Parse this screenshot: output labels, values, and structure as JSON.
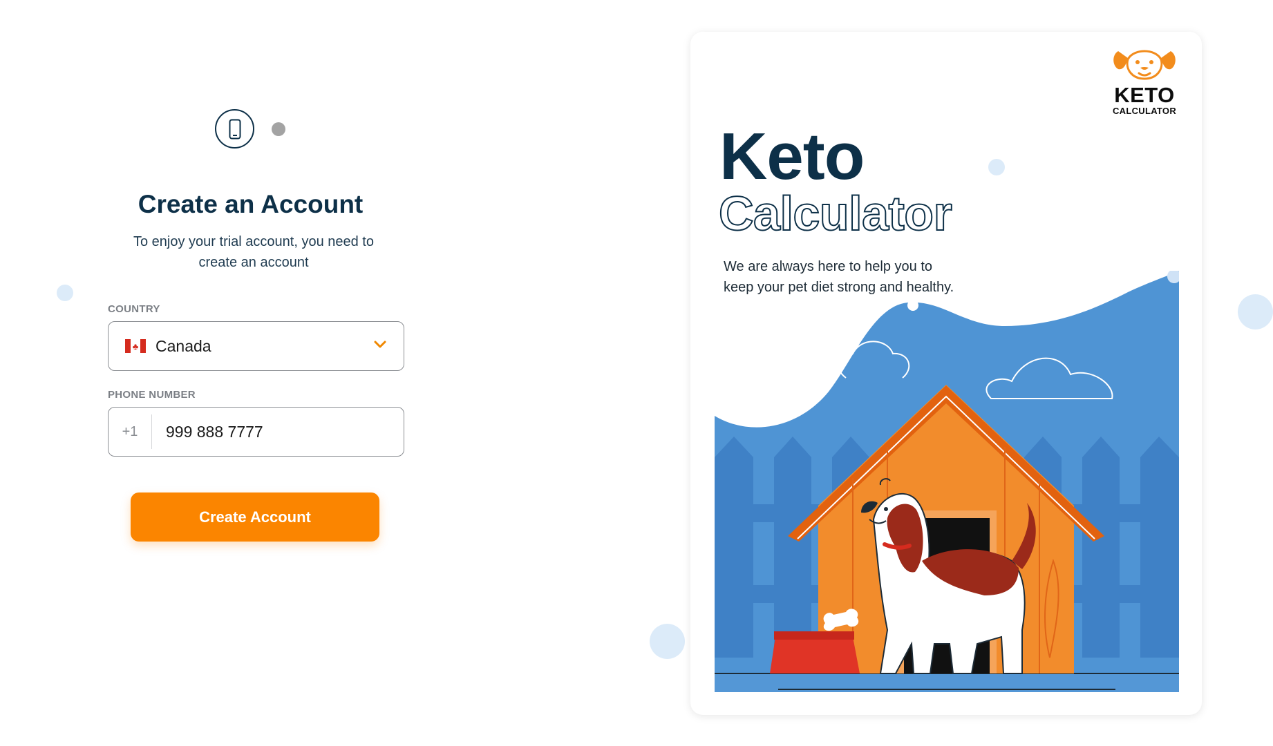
{
  "form": {
    "title": "Create an Account",
    "subtitle": "To enjoy your trial account, you need to create an account",
    "country": {
      "label": "COUNTRY",
      "value": "Canada"
    },
    "phone": {
      "label": "PHONE NUMBER",
      "prefix": "+1",
      "value": "999 888 7777"
    },
    "submit_label": "Create Account"
  },
  "card": {
    "logo_name": "KETO",
    "logo_sub": "CALCULATOR",
    "title": "Keto",
    "title_outline": "Calculator",
    "tagline": "We are always here to help you to keep your pet diet strong and healthy."
  },
  "icons": {
    "step_icon": "smartphone-icon",
    "dropdown_icon": "chevron-down-icon",
    "flag_icon": "canada-flag-icon"
  },
  "colors": {
    "primary": "#0d3048",
    "accent": "#fb8500",
    "illustration_blue": "#4f94d4"
  }
}
